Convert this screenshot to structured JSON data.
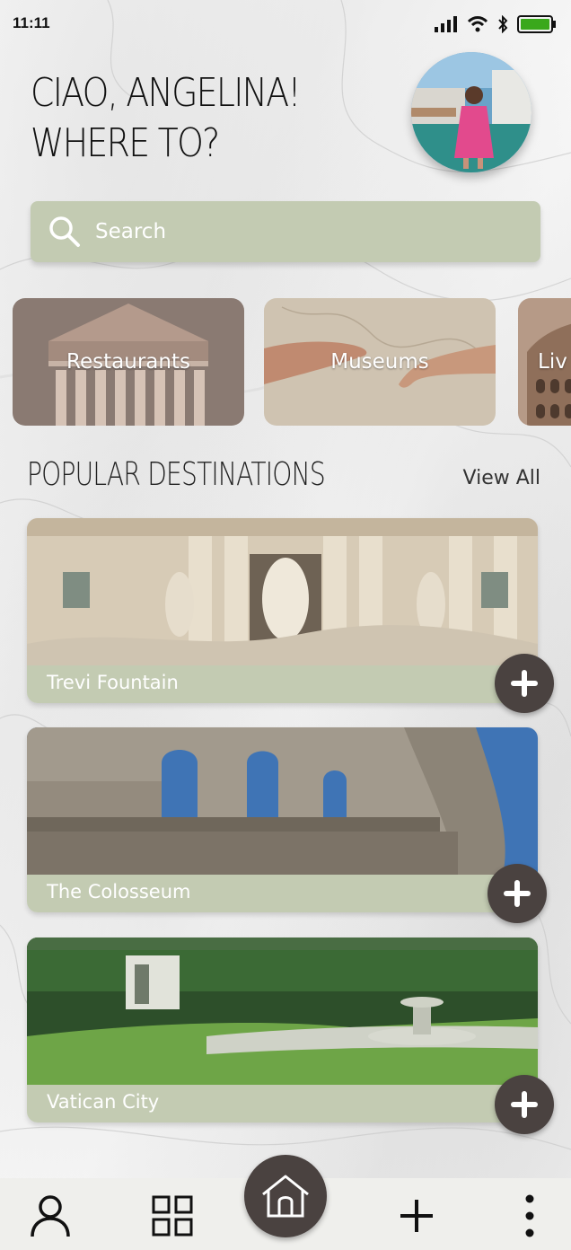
{
  "status": {
    "time": "11:11"
  },
  "greeting": {
    "line1": "CIAO, ANGELINA!",
    "line2": "WHERE TO?"
  },
  "search": {
    "placeholder": "Search"
  },
  "categories": [
    {
      "label": "Restaurants"
    },
    {
      "label": "Museums"
    },
    {
      "label": "Liv"
    }
  ],
  "popular": {
    "title": "POPULAR DESTINATIONS",
    "view_all": "View All",
    "items": [
      {
        "label": "Trevi Fountain"
      },
      {
        "label": "The Colosseum"
      },
      {
        "label": "Vatican City"
      }
    ]
  },
  "colors": {
    "accent": "#c3cbb2",
    "dark": "#4a4240"
  },
  "nav": {
    "items": [
      "profile-icon",
      "grid-icon",
      "home-icon",
      "plus-icon",
      "more-icon"
    ]
  }
}
